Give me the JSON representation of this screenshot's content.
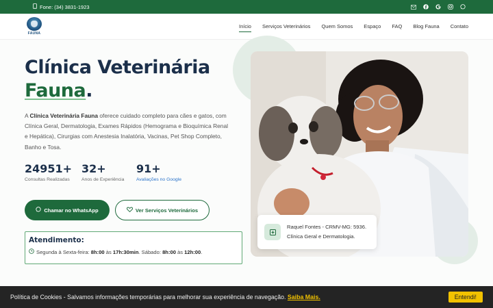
{
  "topbar": {
    "phone": "Fone: (34) 3831-1923",
    "social_icons": [
      "mail-icon",
      "facebook-icon",
      "google-icon",
      "instagram-icon",
      "whatsapp-icon"
    ]
  },
  "logo": {
    "text": "FAUNA"
  },
  "nav": [
    "Início",
    "Serviços Veterinários",
    "Quem Somos",
    "Espaço",
    "FAQ",
    "Blog Fauna",
    "Contato"
  ],
  "hero": {
    "title_line1": "Clínica Veterinária",
    "title_highlight": "Fauna",
    "title_dot": ".",
    "intro_prefix": "A ",
    "intro_bold": "Clínica Veterinária Fauna",
    "intro_rest": " oferece cuidado completo para cães e gatos, com Clínica Geral, Dermatologia, Exames Rápidos (Hemograma e Bioquímica Renal e Hepática), Cirurgias com Anestesia Inalatória, Vacinas, Pet Shop Completo, Banho e Tosa."
  },
  "stats": [
    {
      "num": "24951+",
      "label": "Consultas Realizadas"
    },
    {
      "num": "32+",
      "label": "Anos de Experiência"
    },
    {
      "num": "91+",
      "label": "Avaliações no Google"
    }
  ],
  "buttons": {
    "whatsapp": "Chamar no WhatsApp",
    "services": "Ver Serviços Veterinários"
  },
  "hours": {
    "title": "Atendimento:",
    "weekday_label": "Segunda à Sexta-feira: ",
    "weekday_open": "8h:00",
    "weekday_sep": " às ",
    "weekday_close": "17h:30min",
    "sat_label": ". Sábado: ",
    "sat_open": "8h:00",
    "sat_sep": " às ",
    "sat_close": "12h:00",
    "end": "."
  },
  "vet": {
    "name_line": "Raquel Fontes - CRMV-MG: 5936.",
    "specialty": "Clínica Geral e Dermatologia."
  },
  "cookie": {
    "text": "Política de Cookies - Salvamos informações temporárias para melhorar sua experiência de navegação.",
    "link": "Saiba Mais.",
    "accept": "Entendi!"
  },
  "colors": {
    "brand_green": "#1e6a3c",
    "navy": "#1b2f4a",
    "cookie_accent": "#f2c200"
  }
}
